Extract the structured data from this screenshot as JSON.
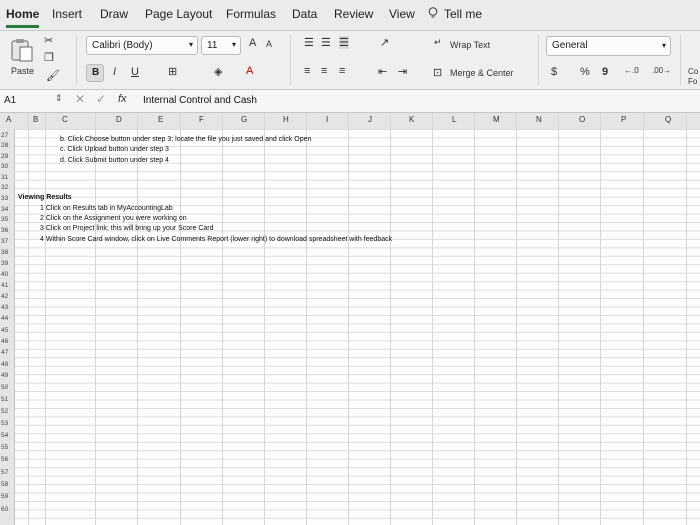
{
  "tabs": [
    "Home",
    "Insert",
    "Draw",
    "Page Layout",
    "Formulas",
    "Data",
    "Review",
    "View"
  ],
  "tell_me": "Tell me",
  "clipboard": {
    "paste_label": "Paste"
  },
  "font": {
    "name": "Calibri (Body)",
    "size": "11",
    "bold": "B",
    "italic": "I",
    "underline": "U",
    "grow": "A",
    "shrink": "A"
  },
  "alignment": {
    "wrap_text": "Wrap Text",
    "merge_center": "Merge & Center"
  },
  "number": {
    "format": "General",
    "currency": "$",
    "percent": "%",
    "comma": "9"
  },
  "styles": {
    "cond_top": "Co",
    "cond_bottom": "Fo"
  },
  "formula_bar": {
    "cell_ref": "A1",
    "fx": "fx",
    "content": "Internal Control and Cash"
  },
  "columns": [
    "A",
    "B",
    "C",
    "D",
    "E",
    "F",
    "G",
    "H",
    "I",
    "J",
    "K",
    "L",
    "M",
    "N",
    "O",
    "P",
    "Q"
  ],
  "rows": [
    "27",
    "28",
    "29",
    "30",
    "31",
    "32",
    "33",
    "34",
    "35",
    "36",
    "37",
    "38",
    "39",
    "40",
    "41",
    "42",
    "43",
    "44",
    "45",
    "46",
    "47",
    "48",
    "49",
    "50",
    "51",
    "52",
    "53",
    "54",
    "55",
    "56",
    "57",
    "58",
    "59",
    "60"
  ],
  "cells": {
    "r27": "b.  Click Choose button under step 3; locate the file you just saved and click Open",
    "r28": "c.  Click Upload button under step 3",
    "r29": "d.  Click Submit button under step 4",
    "r32": "Viewing Results",
    "r33": "1  Click on Results tab in MyAccountingLab",
    "r34": "2  Click on the Assignment you were working on",
    "r35": "3  Click on Project link; this will bring up your Score Card",
    "r36": "4  Within Score Card window, click on Live Comments Report (lower right) to download spreadsheet with feedback"
  }
}
